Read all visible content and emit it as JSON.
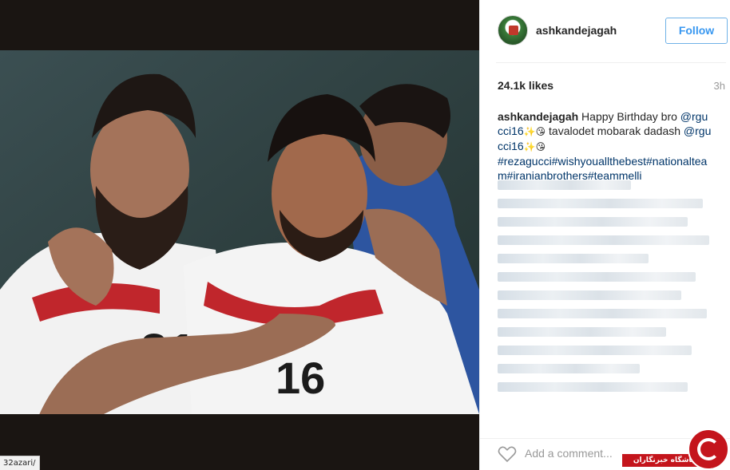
{
  "post": {
    "username": "ashkandejagah",
    "follow_label": "Follow",
    "likes": "24.1k likes",
    "time": "3h",
    "caption": {
      "username": "ashkandejagah",
      "text_1": " Happy Birthday bro ",
      "mention_1": "@rgucci16",
      "emoji_1": "✨😘",
      "text_2": " tavalodet mobarak dadash ",
      "mention_2": "@rgucci16",
      "emoji_2": "✨😘",
      "hashtags": "#rezagucci#wishyouallthebest#nationalteam#iranianbrothers#teammelli"
    },
    "comment_placeholder": "Add a comment..."
  },
  "browser": {
    "status_url": "32azari/"
  },
  "watermark": {
    "text": "باشگاه خبرنگاران"
  },
  "icons": {
    "heart": "heart-icon",
    "avatar": "avatar"
  }
}
